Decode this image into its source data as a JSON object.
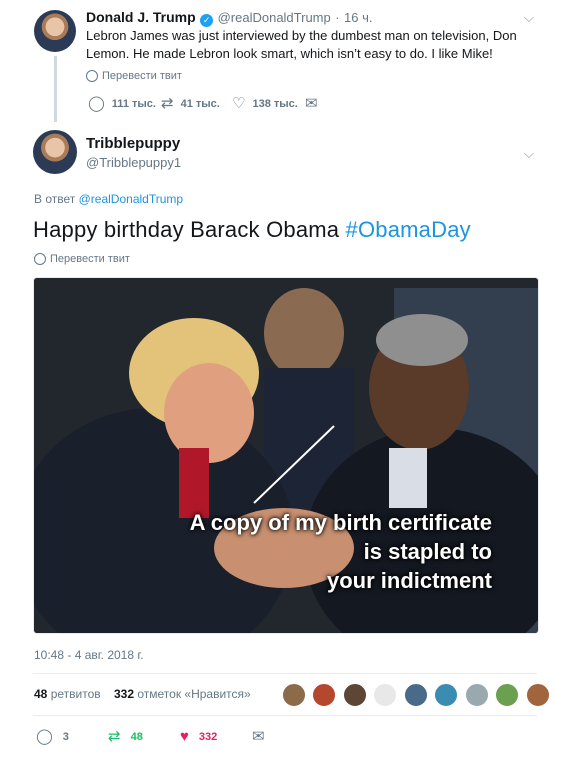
{
  "original_tweet": {
    "name": "Donald J. Trump",
    "handle": "@realDonaldTrump",
    "separator": "·",
    "time": "16 ч.",
    "text": "Lebron James was just interviewed by the dumbest man on television, Don Lemon. He made Lebron look smart, which isn’t easy to do. I like Mike!",
    "translate": "Перевести твит",
    "replies": "111 тыс.",
    "retweets": "41 тыс.",
    "likes": "138 тыс."
  },
  "reply_tweet": {
    "name": "Tribblepuppy",
    "handle": "@Tribblepuppy1",
    "reply_prefix": "В ответ",
    "reply_target": "@realDonaldTrump",
    "text": "Happy birthday Barack Obama ",
    "hashtag": "#ObamaDay",
    "translate": "Перевести твит",
    "image_caption_line1": "A copy of my birth certificate",
    "image_caption_line2": "is stapled to",
    "image_caption_line3": "your indictment",
    "timestamp": "10:48 - 4 авг. 2018 г.",
    "retweet_count": "48",
    "retweet_label": "ретвитов",
    "like_count": "332",
    "like_label": "отметок «Нравится»",
    "replies": "3",
    "retweets": "48",
    "likes": "332"
  },
  "colors": {
    "link": "#1b95e0",
    "retweet_green": "#17bf63",
    "like_red": "#e0245e",
    "muted": "#657786"
  },
  "icons": {
    "reply": "reply-icon",
    "retweet": "retweet-icon",
    "like": "heart-icon",
    "dm": "envelope-icon",
    "verified": "verified-badge-icon",
    "caret": "chevron-down-icon",
    "translate": "globe-icon"
  }
}
